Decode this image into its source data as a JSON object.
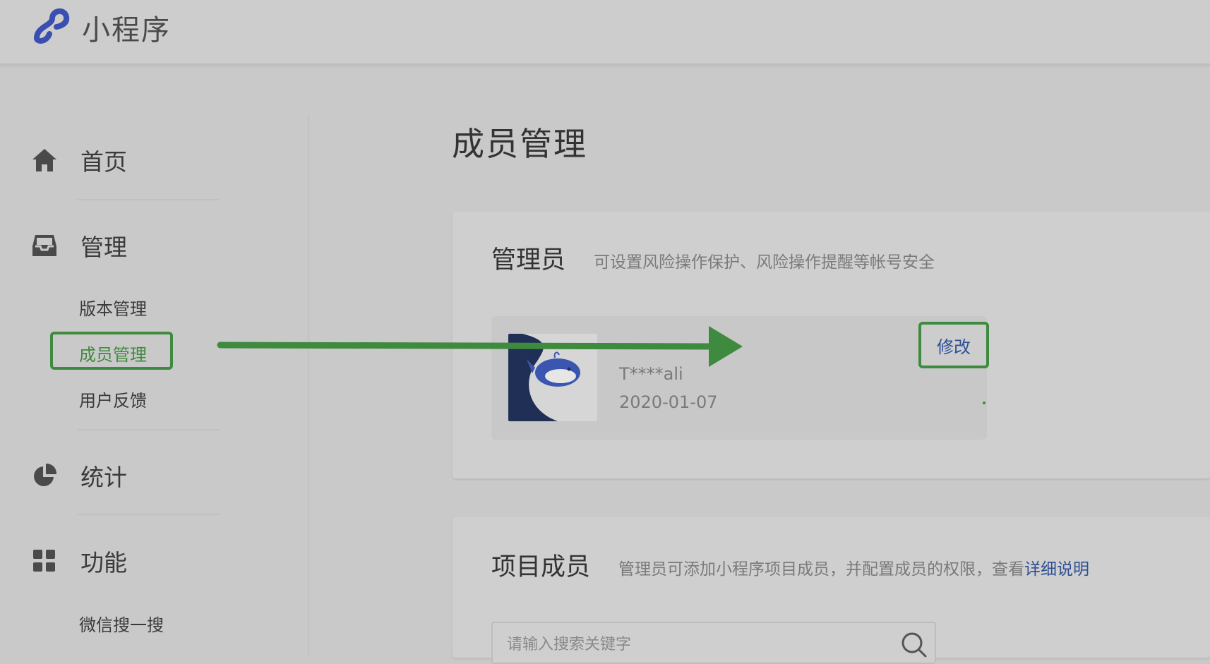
{
  "header": {
    "app_title": "小程序",
    "logo_icon": "mini-program-logo"
  },
  "sidebar": {
    "sections": [
      {
        "label": "首页",
        "icon": "home-icon"
      },
      {
        "label": "管理",
        "icon": "inbox-icon",
        "items": [
          "版本管理",
          "成员管理",
          "用户反馈"
        ]
      },
      {
        "label": "统计",
        "icon": "pie-chart-icon"
      },
      {
        "label": "功能",
        "icon": "grid-icon",
        "items": [
          "微信搜一搜"
        ]
      }
    ],
    "active_item": "成员管理"
  },
  "main": {
    "page_title": "成员管理",
    "admin_card": {
      "title": "管理员",
      "desc": "可设置风险操作保护、风险操作提醒等帐号安全",
      "admin_name": "T****ali",
      "admin_date": "2020-01-07",
      "edit_label": "修改"
    },
    "members_card": {
      "title": "项目成员",
      "desc": "管理员可添加小程序项目成员，并配置成员的权限，查看",
      "desc_link": "详细说明",
      "search_placeholder": "请输入搜索关键字"
    }
  },
  "colors": {
    "accent_green": "#3e8a3e",
    "link_blue": "#2f4f95",
    "logo_blue": "#3b4fb0"
  }
}
